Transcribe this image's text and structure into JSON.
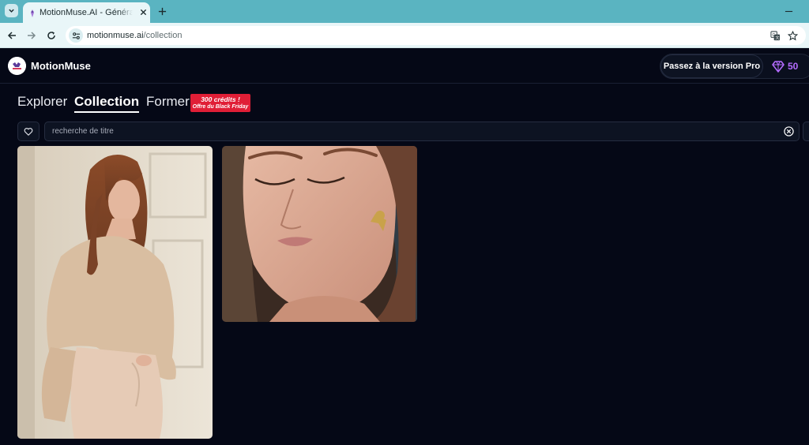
{
  "browser": {
    "tab_title": "MotionMuse.AI - Générateur de",
    "url_host": "motionmuse.ai",
    "url_path": "/collection",
    "icons": [
      "tab-menu-icon",
      "favicon-icon",
      "close-icon",
      "plus-icon",
      "minimize-icon",
      "back-icon",
      "forward-icon",
      "reload-icon",
      "site-info-icon",
      "translate-icon",
      "star-icon"
    ]
  },
  "header": {
    "brand": "MotionMuse",
    "pro_button": "Passez à la version Pro",
    "credits": "50",
    "credits_icon": "diamond-icon",
    "accent": "#b46cff"
  },
  "nav": {
    "tabs": [
      {
        "label": "Explorer",
        "active": false
      },
      {
        "label": "Collection",
        "active": true
      },
      {
        "label": "Former",
        "active": false
      }
    ],
    "promo_line1": "300 crédits !",
    "promo_line2": "Offre du Black Friday",
    "promo_color": "#e01e36"
  },
  "search": {
    "placeholder": "recherche de titre",
    "favorite_icon": "heart-icon",
    "clear_icon": "clear-icon"
  },
  "gallery": {
    "items": [
      {
        "kind": "portrait",
        "subject": "woman-in-beige-outfit"
      },
      {
        "kind": "closeup",
        "subject": "woman-closeup-eyes-closed"
      }
    ]
  }
}
